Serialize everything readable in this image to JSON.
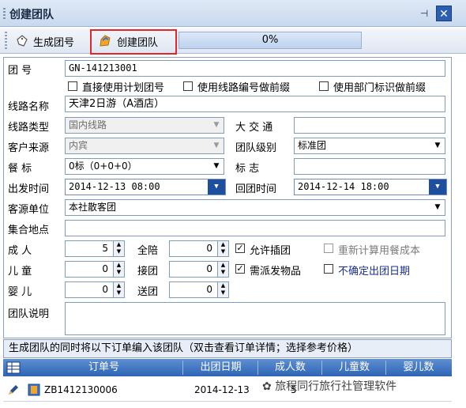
{
  "window": {
    "title": "创建团队"
  },
  "toolbar": {
    "generate_label": "生成团号",
    "create_label": "创建团队",
    "progress_text": "0%",
    "progress_value": 0
  },
  "form": {
    "group_no": {
      "label": "团        号",
      "value": "GN-141213001"
    },
    "checks": [
      {
        "label": "直接使用计划团号",
        "checked": false
      },
      {
        "label": "使用线路编号做前缀",
        "checked": false
      },
      {
        "label": "使用部门标识做前缀",
        "checked": false
      }
    ],
    "route_name": {
      "label": "线路名称",
      "value": "天津2日游（A酒店）"
    },
    "route_type": {
      "label": "线路类型",
      "value": "国内线路"
    },
    "transport": {
      "label": "大 交 通",
      "value": ""
    },
    "source": {
      "label": "客户来源",
      "value": "内宾"
    },
    "level": {
      "label": "团队级别",
      "value": "标准团"
    },
    "meal": {
      "label": "餐    标",
      "value": "0标（0+0+0）"
    },
    "flag": {
      "label": "标    志",
      "value": ""
    },
    "depart_time": {
      "label": "出发时间",
      "value": "2014-12-13 08:00"
    },
    "return_time": {
      "label": "回团时间",
      "value": "2014-12-14 18:00"
    },
    "source_unit": {
      "label": "客源单位",
      "value": "本社散客团"
    },
    "meeting_place": {
      "label": "集合地点",
      "value": ""
    },
    "adult": {
      "label": "成    人",
      "value": "5"
    },
    "child": {
      "label": "儿    童",
      "value": "0"
    },
    "infant": {
      "label": "婴    儿",
      "value": "0"
    },
    "escort": {
      "label": "全陪",
      "value": "0"
    },
    "pickup": {
      "label": "接团",
      "value": "0"
    },
    "dropoff": {
      "label": "送团",
      "value": "0"
    },
    "allow_insert": {
      "label": "允许插团",
      "checked": true
    },
    "recalc_meal": {
      "label": "重新计算用餐成本",
      "checked": false
    },
    "need_items": {
      "label": "需派发物品",
      "checked": true
    },
    "uncertain_date": {
      "label": "不确定出团日期",
      "checked": false
    },
    "description": {
      "label": "团队说明",
      "value": ""
    }
  },
  "grid": {
    "caption": "生成团队的同时将以下订单编入该团队（双击查看订单详情；选择参考价格）",
    "columns": [
      "订单号",
      "出团日期",
      "成人数",
      "儿童数",
      "婴儿数"
    ],
    "rows": [
      {
        "order_no": "ZB1412130006",
        "date": "2014-12-13",
        "adult": "5",
        "child": "",
        "infant": ""
      }
    ]
  },
  "watermark": "旅程同行旅行社管理软件"
}
